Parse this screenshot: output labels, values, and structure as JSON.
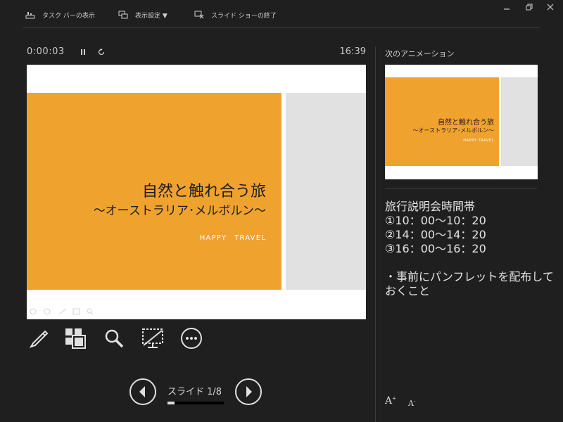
{
  "toolbar": {
    "taskbar_label": "タスク バーの表示",
    "display_settings_label": "表示設定 ▼",
    "end_show_label": "スライド ショーの終了"
  },
  "timer": {
    "elapsed": "0:00:03",
    "clock": "16:39"
  },
  "current_slide": {
    "title": "自然と触れ合う旅",
    "subtitle": "～オーストラリア･メルボルン～",
    "brand": "HAPPY　TRAVEL"
  },
  "navigation": {
    "slide_counter": "スライド 1/8",
    "current": 1,
    "total": 8
  },
  "next_panel": {
    "title": "次のアニメーション",
    "slide_title": "自然と触れ合う旅",
    "slide_subtitle": "～オーストラリア･メルボルン～",
    "slide_brand": "HAPPY TRAVEL"
  },
  "notes": {
    "lines": [
      "旅行説明会時間帯",
      "①10：00～10：20",
      "②14：00～14：20",
      "③16：00～16：20"
    ],
    "extra": [
      "・事前にパンフレットを配布して",
      "おくこと"
    ]
  },
  "icons": {
    "pen": "pen-icon",
    "slides": "see-all-slides-icon",
    "zoom": "zoom-icon",
    "screen": "black-screen-icon",
    "more": "more-options-icon",
    "prev": "previous-arrow-icon",
    "next": "next-arrow-icon"
  },
  "colors": {
    "background": "#1f1f1f",
    "slide_orange": "#f0a22f",
    "slide_grey": "#e1e1e1"
  }
}
